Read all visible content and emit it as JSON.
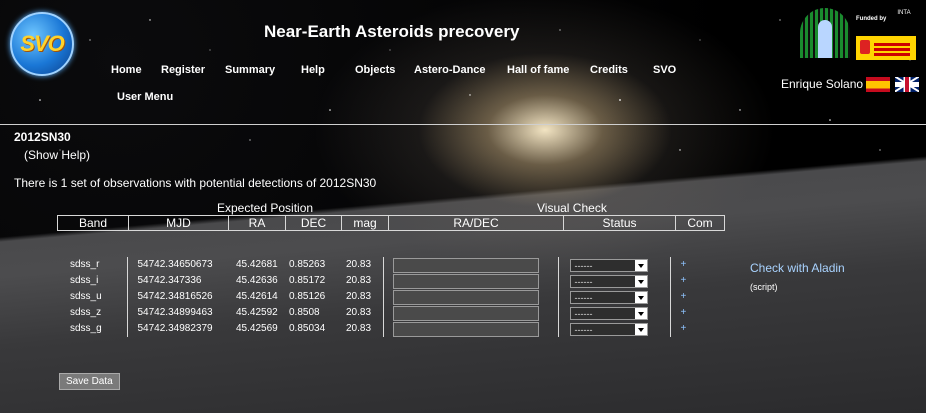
{
  "header": {
    "logo_text": "SVO",
    "title": "Near-Earth Asteroids precovery",
    "nav": [
      "Home",
      "Register",
      "Summary",
      "Help",
      "Objects",
      "Astero-Dance",
      "Hall of fame",
      "Credits",
      "SVO"
    ],
    "user_menu": "User Menu",
    "funded_by": "Funded by",
    "sponsor_short": "INTA",
    "user_name": "Enrique Solano",
    "flags": [
      "spain-flag-icon",
      "uk-flag-icon"
    ]
  },
  "content": {
    "object_name": "2012SN30",
    "show_help": "(Show Help)",
    "observations_message": "There is 1 set of observations with potential detections of 2012SN30",
    "group_headers": [
      "Expected Position",
      "Visual Check"
    ],
    "columns": [
      "Band",
      "MJD",
      "RA",
      "DEC",
      "mag",
      "RA/DEC",
      "Status",
      "Com"
    ],
    "rows": [
      {
        "band": "sdss_r",
        "mjd": "54742.34650673",
        "ra": "45.42681",
        "dec": "0.85263",
        "mag": "20.83",
        "status": "------",
        "com": "+"
      },
      {
        "band": "sdss_i",
        "mjd": "54742.347336",
        "ra": "45.42636",
        "dec": "0.85172",
        "mag": "20.83",
        "status": "------",
        "com": "+"
      },
      {
        "band": "sdss_u",
        "mjd": "54742.34816526",
        "ra": "45.42614",
        "dec": "0.85126",
        "mag": "20.83",
        "status": "------",
        "com": "+"
      },
      {
        "band": "sdss_z",
        "mjd": "54742.34899463",
        "ra": "45.42592",
        "dec": "0.8508",
        "mag": "20.83",
        "status": "------",
        "com": "+"
      },
      {
        "band": "sdss_g",
        "mjd": "54742.34982379",
        "ra": "45.42569",
        "dec": "0.85034",
        "mag": "20.83",
        "status": "------",
        "com": "+"
      }
    ],
    "aladin_link": "Check with Aladin",
    "aladin_note": "(script)",
    "save_button": "Save Data"
  },
  "colors": {
    "link": "#a9d3ff",
    "background": "#000000",
    "text": "#ffffff"
  }
}
